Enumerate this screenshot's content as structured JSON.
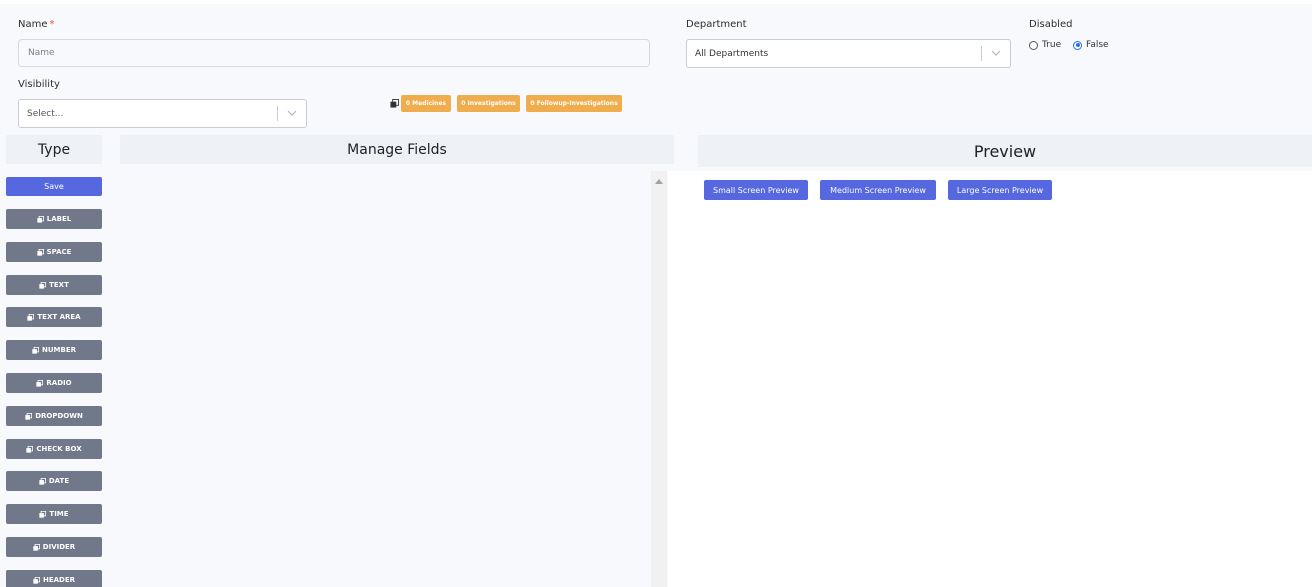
{
  "form": {
    "name_label": "Name",
    "name_required": "*",
    "name_placeholder": "Name",
    "department_label": "Department",
    "department_value": "All Departments",
    "disabled_label": "Disabled",
    "disabled_options": [
      "True",
      "False"
    ],
    "disabled_selected": "False",
    "visibility_label": "Visibility",
    "visibility_placeholder": "Select..."
  },
  "badges": [
    "0 Medicines",
    "0 Investigations",
    "0 Followup-Investigations"
  ],
  "type_panel": {
    "title": "Type",
    "save_label": "Save",
    "items": [
      "LABEL",
      "SPACE",
      "TEXT",
      "TEXT AREA",
      "NUMBER",
      "RADIO",
      "DROPDOWN",
      "CHECK BOX",
      "DATE",
      "TIME",
      "DIVIDER",
      "HEADER"
    ]
  },
  "manage_fields": {
    "title": "Manage Fields"
  },
  "preview": {
    "title": "Preview",
    "buttons": [
      "Small Screen Preview",
      "Medium Screen Preview",
      "Large Screen Preview"
    ]
  },
  "colors": {
    "primary": "#5568e0",
    "type_button": "#71788a",
    "badge": "#f0ad4e",
    "radio_selected": "#2a6ef0"
  },
  "icons": {
    "select_arrow": "chevron-down-icon",
    "copy": "copy-icon",
    "scroll_up": "triangle-up-icon"
  }
}
